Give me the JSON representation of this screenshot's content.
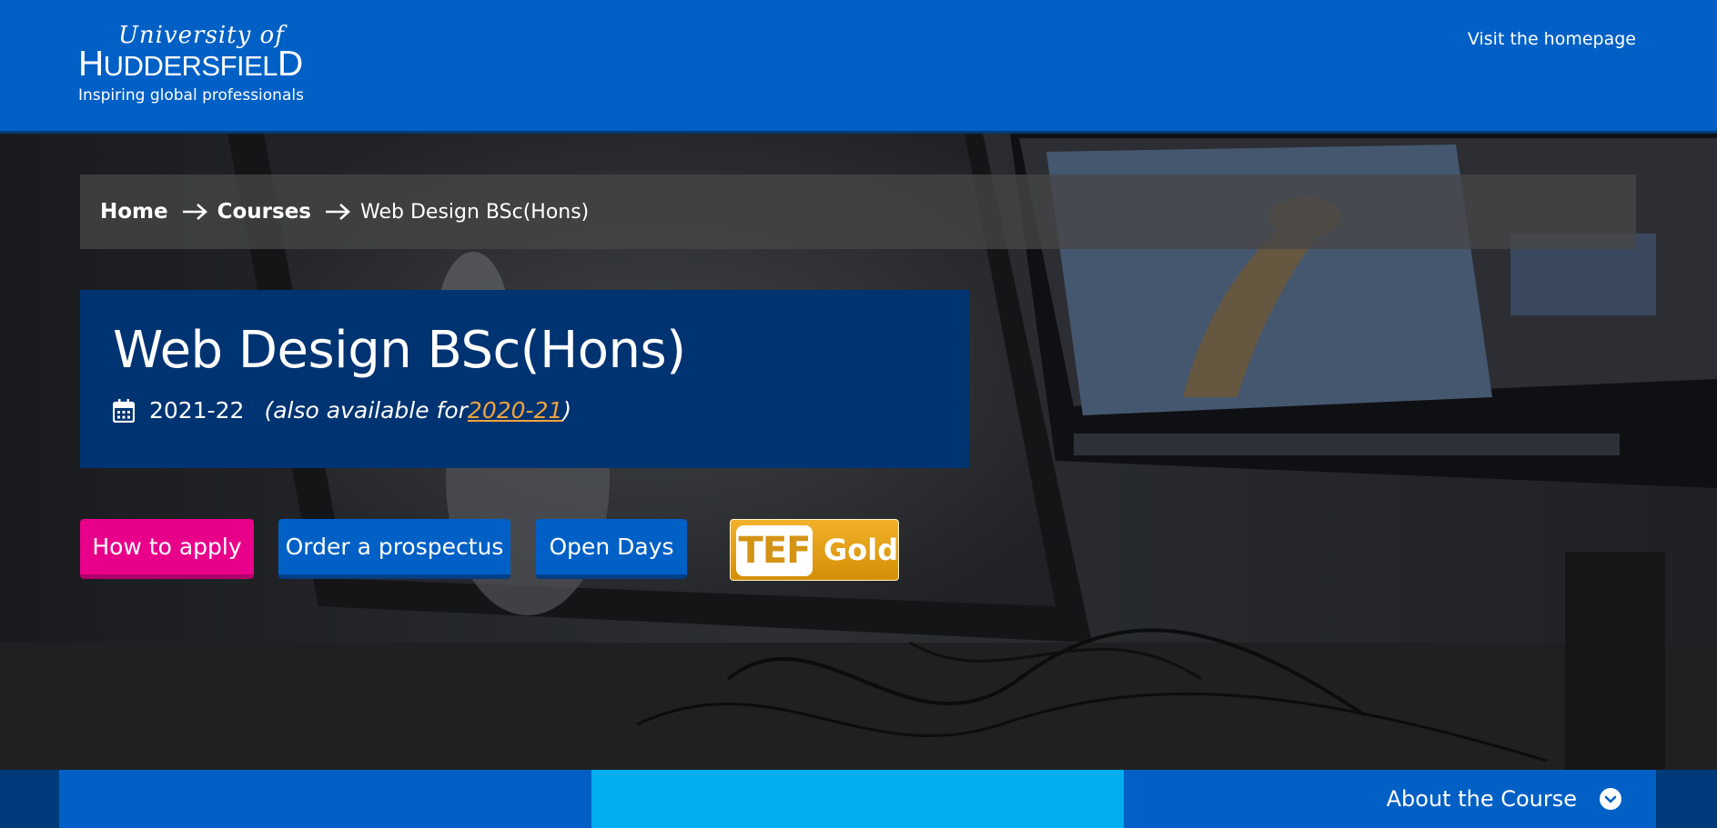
{
  "header": {
    "logo": {
      "line1": "University of",
      "name_first": "H",
      "name_rest": "UDDERSFIEL",
      "name_last": "D",
      "tagline": "Inspiring global professionals"
    },
    "visit_link": "Visit the homepage"
  },
  "breadcrumb": {
    "items": [
      {
        "label": "Home"
      },
      {
        "label": "Courses"
      }
    ],
    "current": "Web Design BSc(Hons)"
  },
  "course": {
    "title": "Web Design BSc(Hons)",
    "year": "2021-22",
    "also_prefix": "(also available for ",
    "also_link": "2020-21",
    "also_suffix": ")"
  },
  "actions": {
    "apply": "How to apply",
    "prospectus": "Order a prospectus",
    "open_days": "Open Days"
  },
  "tef": {
    "left": "TEF",
    "right": "Gold"
  },
  "bottom_nav": {
    "about": "About the Course"
  },
  "colors": {
    "header_blue": "#0060c6",
    "title_navy": "#003371",
    "apply_pink": "#e8008a",
    "tab_cyan": "#00adee",
    "link_orange": "#f0a33c",
    "tef_gold": "#e0a016"
  },
  "icons": {
    "breadcrumb_separator": "arrow-right-icon",
    "year": "calendar-icon",
    "about": "chevron-down-circle-icon"
  }
}
